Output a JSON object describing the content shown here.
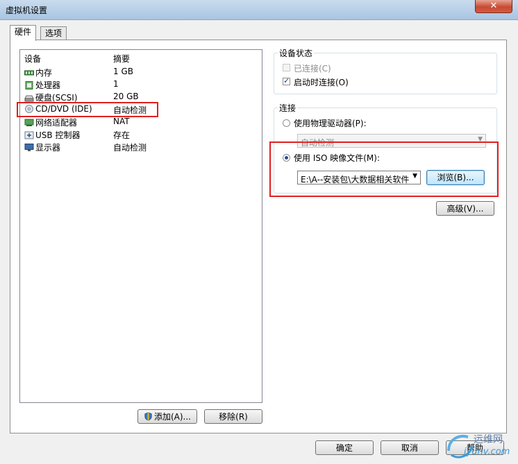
{
  "window": {
    "title": "虚拟机设置",
    "close_symbol": "✕"
  },
  "tabs": [
    {
      "label": "硬件",
      "active": true
    },
    {
      "label": "选项",
      "active": false
    }
  ],
  "device_list": {
    "columns": [
      "设备",
      "摘要"
    ],
    "rows": [
      {
        "device": "内存",
        "summary": "1 GB",
        "icon": "memory-icon"
      },
      {
        "device": "处理器",
        "summary": "1",
        "icon": "cpu-icon"
      },
      {
        "device": "硬盘(SCSI)",
        "summary": "20 GB",
        "icon": "harddisk-icon"
      },
      {
        "device": "CD/DVD (IDE)",
        "summary": "自动检测",
        "icon": "cd-dvd-icon",
        "highlighted": true
      },
      {
        "device": "网络适配器",
        "summary": "NAT",
        "icon": "network-adapter-icon"
      },
      {
        "device": "USB 控制器",
        "summary": "存在",
        "icon": "usb-icon"
      },
      {
        "device": "显示器",
        "summary": "自动检测",
        "icon": "monitor-icon"
      }
    ]
  },
  "buttons": {
    "add": "添加(A)...",
    "remove": "移除(R)",
    "browse": "浏览(B)...",
    "advanced": "高级(V)...",
    "ok": "确定",
    "cancel": "取消",
    "help": "帮助"
  },
  "device_status": {
    "title": "设备状态",
    "connected": {
      "label": "已连接(C)",
      "checked": false,
      "disabled": true
    },
    "connect_on_power": {
      "label": "启动时连接(O)",
      "checked": true
    }
  },
  "connection": {
    "title": "连接",
    "physical": {
      "label": "使用物理驱动器(P):",
      "selected": false,
      "dropdown_value": "自动检测"
    },
    "iso": {
      "label": "使用 ISO 映像文件(M):",
      "selected": true,
      "path_value": "E:\\A--安装包\\大数据相关软件"
    }
  },
  "watermark": {
    "title": "运维网",
    "url": "iyunv.com"
  },
  "colors": {
    "highlight_red": "#e0201f",
    "accent_blue": "#3c7fb1"
  }
}
